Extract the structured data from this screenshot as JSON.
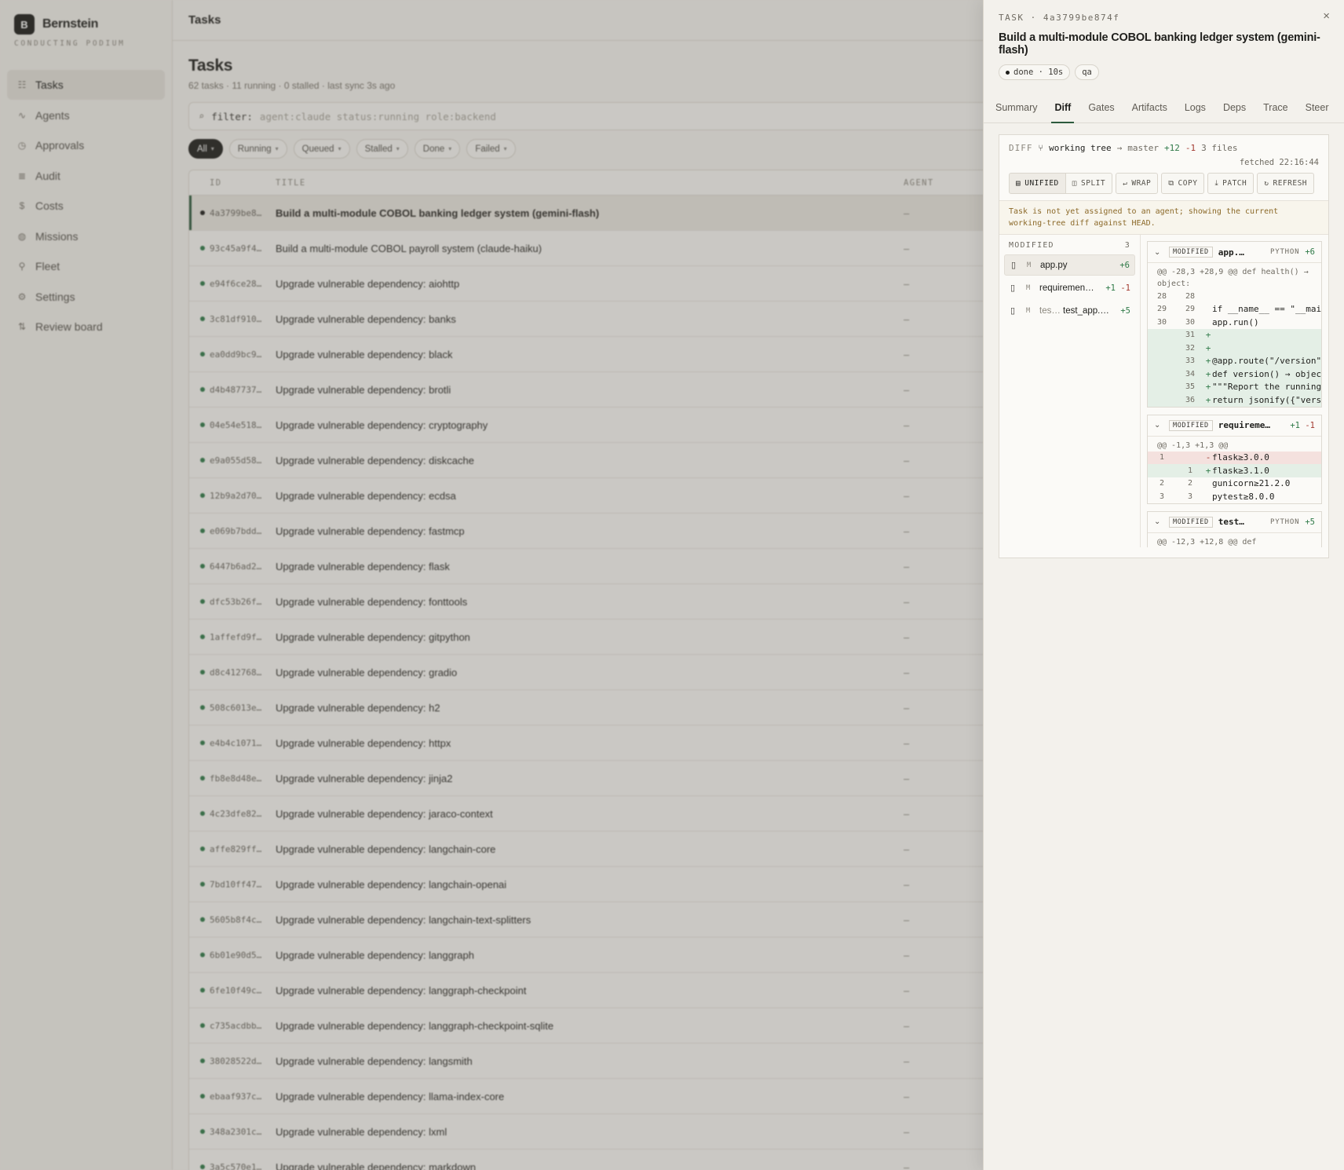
{
  "sidebar": {
    "brand_initial": "B",
    "brand_name": "Bernstein",
    "brand_sub": "CONDUCTING PODIUM",
    "items": [
      {
        "label": "Tasks",
        "icon": "tasks-icon",
        "glyph": "☷"
      },
      {
        "label": "Agents",
        "icon": "activity-icon",
        "glyph": "∿"
      },
      {
        "label": "Approvals",
        "icon": "clock-icon",
        "glyph": "◷"
      },
      {
        "label": "Audit",
        "icon": "list-icon",
        "glyph": "≣"
      },
      {
        "label": "Costs",
        "icon": "dollar-icon",
        "glyph": "$"
      },
      {
        "label": "Missions",
        "icon": "globe-icon",
        "glyph": "◍"
      },
      {
        "label": "Fleet",
        "icon": "network-icon",
        "glyph": "⚲"
      },
      {
        "label": "Settings",
        "icon": "gear-icon",
        "glyph": "⚙"
      },
      {
        "label": "Review board",
        "icon": "git-pull-icon",
        "glyph": "⇅"
      }
    ]
  },
  "main": {
    "topbar_title": "Tasks",
    "heading": "Tasks",
    "subline": "62 tasks · 11 running · 0 stalled · last sync 3s  ago",
    "filter_key": "filter:",
    "filter_placeholder": "agent:claude status:running role:backend",
    "chips": [
      "All",
      "Running",
      "Queued",
      "Stalled",
      "Done",
      "Failed"
    ],
    "columns": {
      "id": "ID",
      "title": "TITLE",
      "agent": "AGENT"
    },
    "rows": [
      {
        "id": "4a3799be8…",
        "title": "Build a multi-module COBOL banking ledger system (gemini-flash)",
        "agent": "–"
      },
      {
        "id": "93c45a9f4…",
        "title": "Build a multi-module COBOL payroll system (claude-haiku)",
        "agent": "–"
      },
      {
        "id": "e94f6ce28…",
        "title": "Upgrade vulnerable dependency: aiohttp",
        "agent": "–"
      },
      {
        "id": "3c81df910…",
        "title": "Upgrade vulnerable dependency: banks",
        "agent": "–"
      },
      {
        "id": "ea0dd9bc9…",
        "title": "Upgrade vulnerable dependency: black",
        "agent": "–"
      },
      {
        "id": "d4b487737…",
        "title": "Upgrade vulnerable dependency: brotli",
        "agent": "–"
      },
      {
        "id": "04e54e518…",
        "title": "Upgrade vulnerable dependency: cryptography",
        "agent": "–"
      },
      {
        "id": "e9a055d58…",
        "title": "Upgrade vulnerable dependency: diskcache",
        "agent": "–"
      },
      {
        "id": "12b9a2d70…",
        "title": "Upgrade vulnerable dependency: ecdsa",
        "agent": "–"
      },
      {
        "id": "e069b7bdd…",
        "title": "Upgrade vulnerable dependency: fastmcp",
        "agent": "–"
      },
      {
        "id": "6447b6ad2…",
        "title": "Upgrade vulnerable dependency: flask",
        "agent": "–"
      },
      {
        "id": "dfc53b26f…",
        "title": "Upgrade vulnerable dependency: fonttools",
        "agent": "–"
      },
      {
        "id": "1affefd9f…",
        "title": "Upgrade vulnerable dependency: gitpython",
        "agent": "–"
      },
      {
        "id": "d8c412768…",
        "title": "Upgrade vulnerable dependency: gradio",
        "agent": "–"
      },
      {
        "id": "508c6013e…",
        "title": "Upgrade vulnerable dependency: h2",
        "agent": "–"
      },
      {
        "id": "e4b4c1071…",
        "title": "Upgrade vulnerable dependency: httpx",
        "agent": "–"
      },
      {
        "id": "fb8e8d48e…",
        "title": "Upgrade vulnerable dependency: jinja2",
        "agent": "–"
      },
      {
        "id": "4c23dfe82…",
        "title": "Upgrade vulnerable dependency: jaraco-context",
        "agent": "–"
      },
      {
        "id": "affe829ff…",
        "title": "Upgrade vulnerable dependency: langchain-core",
        "agent": "–"
      },
      {
        "id": "7bd10ff47…",
        "title": "Upgrade vulnerable dependency: langchain-openai",
        "agent": "–"
      },
      {
        "id": "5605b8f4c…",
        "title": "Upgrade vulnerable dependency: langchain-text-splitters",
        "agent": "–"
      },
      {
        "id": "6b01e90d5…",
        "title": "Upgrade vulnerable dependency: langgraph",
        "agent": "–"
      },
      {
        "id": "6fe10f49c…",
        "title": "Upgrade vulnerable dependency: langgraph-checkpoint",
        "agent": "–"
      },
      {
        "id": "c735acdbb…",
        "title": "Upgrade vulnerable dependency: langgraph-checkpoint-sqlite",
        "agent": "–"
      },
      {
        "id": "38028522d…",
        "title": "Upgrade vulnerable dependency: langsmith",
        "agent": "–"
      },
      {
        "id": "ebaaf937c…",
        "title": "Upgrade vulnerable dependency: llama-index-core",
        "agent": "–"
      },
      {
        "id": "348a2301c…",
        "title": "Upgrade vulnerable dependency: lxml",
        "agent": "–"
      },
      {
        "id": "3a5c570e1…",
        "title": "Upgrade vulnerable dependency: markdown",
        "agent": "–"
      }
    ]
  },
  "drawer": {
    "kicker": "TASK · 4a3799be874f",
    "close": "×",
    "title": "Build a multi-module COBOL banking ledger system (gemini-flash)",
    "status_badge": "done · 10s",
    "role_badge": "qa",
    "tabs": [
      "Summary",
      "Diff",
      "Gates",
      "Artifacts",
      "Logs",
      "Deps",
      "Trace",
      "Steer"
    ],
    "diff": {
      "label": "DIFF",
      "source": "working tree",
      "arrow": "→",
      "target": "master",
      "added": "+12",
      "removed": "-1",
      "files": "3 files",
      "fetched": "fetched 22:16:44",
      "toolbar": [
        "UNIFIED",
        "SPLIT",
        "WRAP",
        "COPY",
        "PATCH",
        "REFRESH"
      ],
      "notice": "Task is not yet assigned to an agent; showing the current working-tree diff against HEAD.",
      "list_title": "MODIFIED",
      "list_count": "3",
      "file_list": [
        {
          "marker": "M",
          "dir": "",
          "name": "app.py",
          "add": "+6",
          "del": ""
        },
        {
          "marker": "M",
          "dir": "",
          "name": "requiremen…",
          "add": "+1",
          "del": "-1"
        },
        {
          "marker": "M",
          "dir": "tes…",
          "name": "test_app.…",
          "add": "+5",
          "del": ""
        }
      ],
      "blocks": [
        {
          "status": "MODIFIED",
          "name": "app.…",
          "lang": "PYTHON",
          "add": "+6",
          "del": "",
          "hunk": "@@ -28,3 +28,9 @@ def health() → object:",
          "lines": [
            {
              "t": "c",
              "o": "28",
              "n": "28",
              "code": ""
            },
            {
              "t": "c",
              "o": "29",
              "n": "29",
              "code": "if __name__ == \"__main__\":"
            },
            {
              "t": "c",
              "o": "30",
              "n": "30",
              "code": "    app.run()"
            },
            {
              "t": "a",
              "o": "",
              "n": "31",
              "code": ""
            },
            {
              "t": "a",
              "o": "",
              "n": "32",
              "code": ""
            },
            {
              "t": "a",
              "o": "",
              "n": "33",
              "code": "@app.route(\"/version\")"
            },
            {
              "t": "a",
              "o": "",
              "n": "34",
              "code": "def version() → object:"
            },
            {
              "t": "a",
              "o": "",
              "n": "35",
              "code": "    \"\"\"Report the running version.\"\"\""
            },
            {
              "t": "a",
              "o": "",
              "n": "36",
              "code": "    return jsonify({\"version\": ...})"
            }
          ]
        },
        {
          "status": "MODIFIED",
          "name": "requireme…",
          "lang": "",
          "add": "+1",
          "del": "-1",
          "hunk": "@@ -1,3 +1,3 @@",
          "lines": [
            {
              "t": "d",
              "o": "1",
              "n": "",
              "code": "flask≥3.0.0"
            },
            {
              "t": "a",
              "o": "",
              "n": "1",
              "code": "flask≥3.1.0"
            },
            {
              "t": "c",
              "o": "2",
              "n": "2",
              "code": "gunicorn≥21.2.0"
            },
            {
              "t": "c",
              "o": "3",
              "n": "3",
              "code": "pytest≥8.0.0"
            }
          ]
        },
        {
          "status": "MODIFIED",
          "name": "test…",
          "lang": "PYTHON",
          "add": "+5",
          "del": "",
          "hunk": "@@ -12,3 +12,8 @@ def",
          "lines": []
        }
      ]
    }
  },
  "colors": {
    "accent": "#2d5a3d",
    "added": "#2f7a48",
    "removed": "#a33a30",
    "warning_text": "#8c6a2a"
  }
}
